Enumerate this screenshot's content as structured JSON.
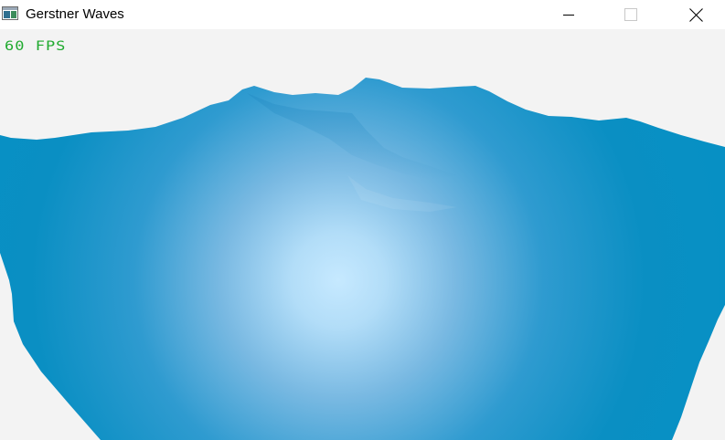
{
  "window": {
    "title": "Gerstner Waves",
    "app_icon": "window-app-icon",
    "controls": {
      "minimize_icon": "minimize-icon",
      "maximize_icon": "maximize-icon",
      "close_icon": "close-icon"
    }
  },
  "overlay": {
    "fps_text": "60 FPS",
    "fps_color": "#1faa2e"
  },
  "scene": {
    "background_color": "#f3f3f3",
    "water_edge_color": "#0790c4",
    "water_highlight_color": "#c6e9ff"
  }
}
